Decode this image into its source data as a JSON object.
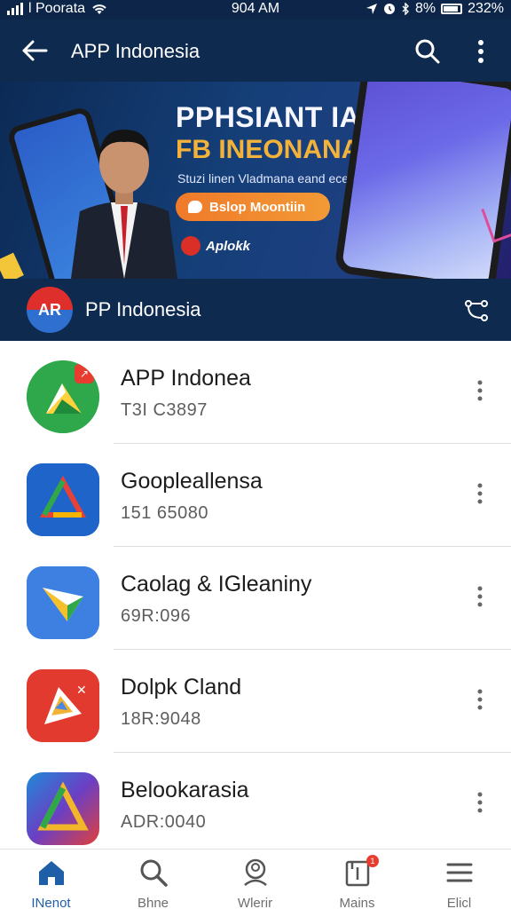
{
  "status_bar": {
    "carrier": "l Poorata",
    "time": "904 AM",
    "battery_percent": "8%",
    "extra": "232%"
  },
  "app_bar": {
    "title": "APP Indonesia",
    "back_icon": "arrow-left-icon",
    "search_icon": "search-icon",
    "more_icon": "more-vertical-icon"
  },
  "banner": {
    "headline_1": "PPHSIANT IANGKE",
    "headline_2": "FB INEONANAIIA",
    "subline": "Stuzi linen Vladmana eand ecenndo",
    "cta_label": "Bslop Moontiin",
    "brand_name": "Aplokk"
  },
  "channel": {
    "logo_text": "AR",
    "name": "PP Indonesia",
    "share_icon": "share-icon"
  },
  "apps": [
    {
      "name": "APP Indonea",
      "sub": "T3I C3897",
      "badge": "↗"
    },
    {
      "name": "Goopleallensa",
      "sub": "151 65080",
      "badge": ""
    },
    {
      "name": "Caolag & IGleaniny",
      "sub": "69R:096",
      "badge": ""
    },
    {
      "name": "Dolpk Cland",
      "sub": "18R:9048",
      "badge": ""
    },
    {
      "name": "Belookarasia",
      "sub": "ADR:0040",
      "badge": ""
    }
  ],
  "bottom_nav": [
    {
      "label": "INenot",
      "icon": "home-icon"
    },
    {
      "label": "Bhne",
      "icon": "search-icon"
    },
    {
      "label": "Wlerir",
      "icon": "account-search-icon"
    },
    {
      "label": "Mains",
      "icon": "notifications-icon",
      "badge": "1"
    },
    {
      "label": "Elicl",
      "icon": "menu-icon"
    }
  ],
  "colors": {
    "primary_dark": "#0f2a4f",
    "accent_orange": "#f07a2a",
    "badge_red": "#e73c2f",
    "nav_active": "#1f5fa8"
  }
}
